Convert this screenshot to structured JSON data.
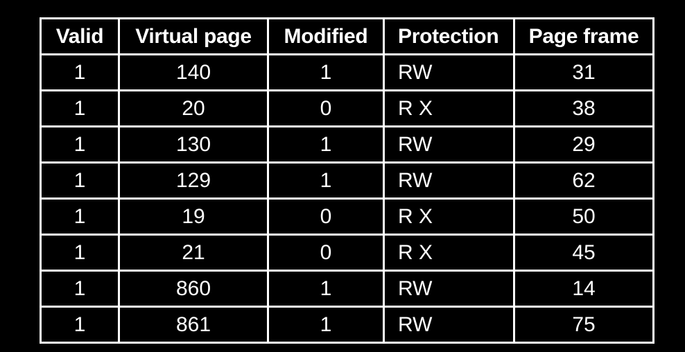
{
  "table": {
    "columns": [
      {
        "key": "valid",
        "label": "Valid",
        "align": "center"
      },
      {
        "key": "virtual",
        "label": "Virtual page",
        "align": "center"
      },
      {
        "key": "modified",
        "label": "Modified",
        "align": "center"
      },
      {
        "key": "protection",
        "label": "Protection",
        "align": "left"
      },
      {
        "key": "frame",
        "label": "Page frame",
        "align": "center"
      }
    ],
    "rows": [
      {
        "valid": "1",
        "virtual": "140",
        "modified": "1",
        "protection": "RW",
        "frame": "31"
      },
      {
        "valid": "1",
        "virtual": "20",
        "modified": "0",
        "protection": "R X",
        "frame": "38"
      },
      {
        "valid": "1",
        "virtual": "130",
        "modified": "1",
        "protection": "RW",
        "frame": "29"
      },
      {
        "valid": "1",
        "virtual": "129",
        "modified": "1",
        "protection": "RW",
        "frame": "62"
      },
      {
        "valid": "1",
        "virtual": "19",
        "modified": "0",
        "protection": "R X",
        "frame": "50"
      },
      {
        "valid": "1",
        "virtual": "21",
        "modified": "0",
        "protection": "R X",
        "frame": "45"
      },
      {
        "valid": "1",
        "virtual": "860",
        "modified": "1",
        "protection": "RW",
        "frame": "14"
      },
      {
        "valid": "1",
        "virtual": "861",
        "modified": "1",
        "protection": "RW",
        "frame": "75"
      }
    ]
  },
  "colors": {
    "background": "#000000",
    "text": "#ffffff",
    "border": "#ffffff"
  }
}
